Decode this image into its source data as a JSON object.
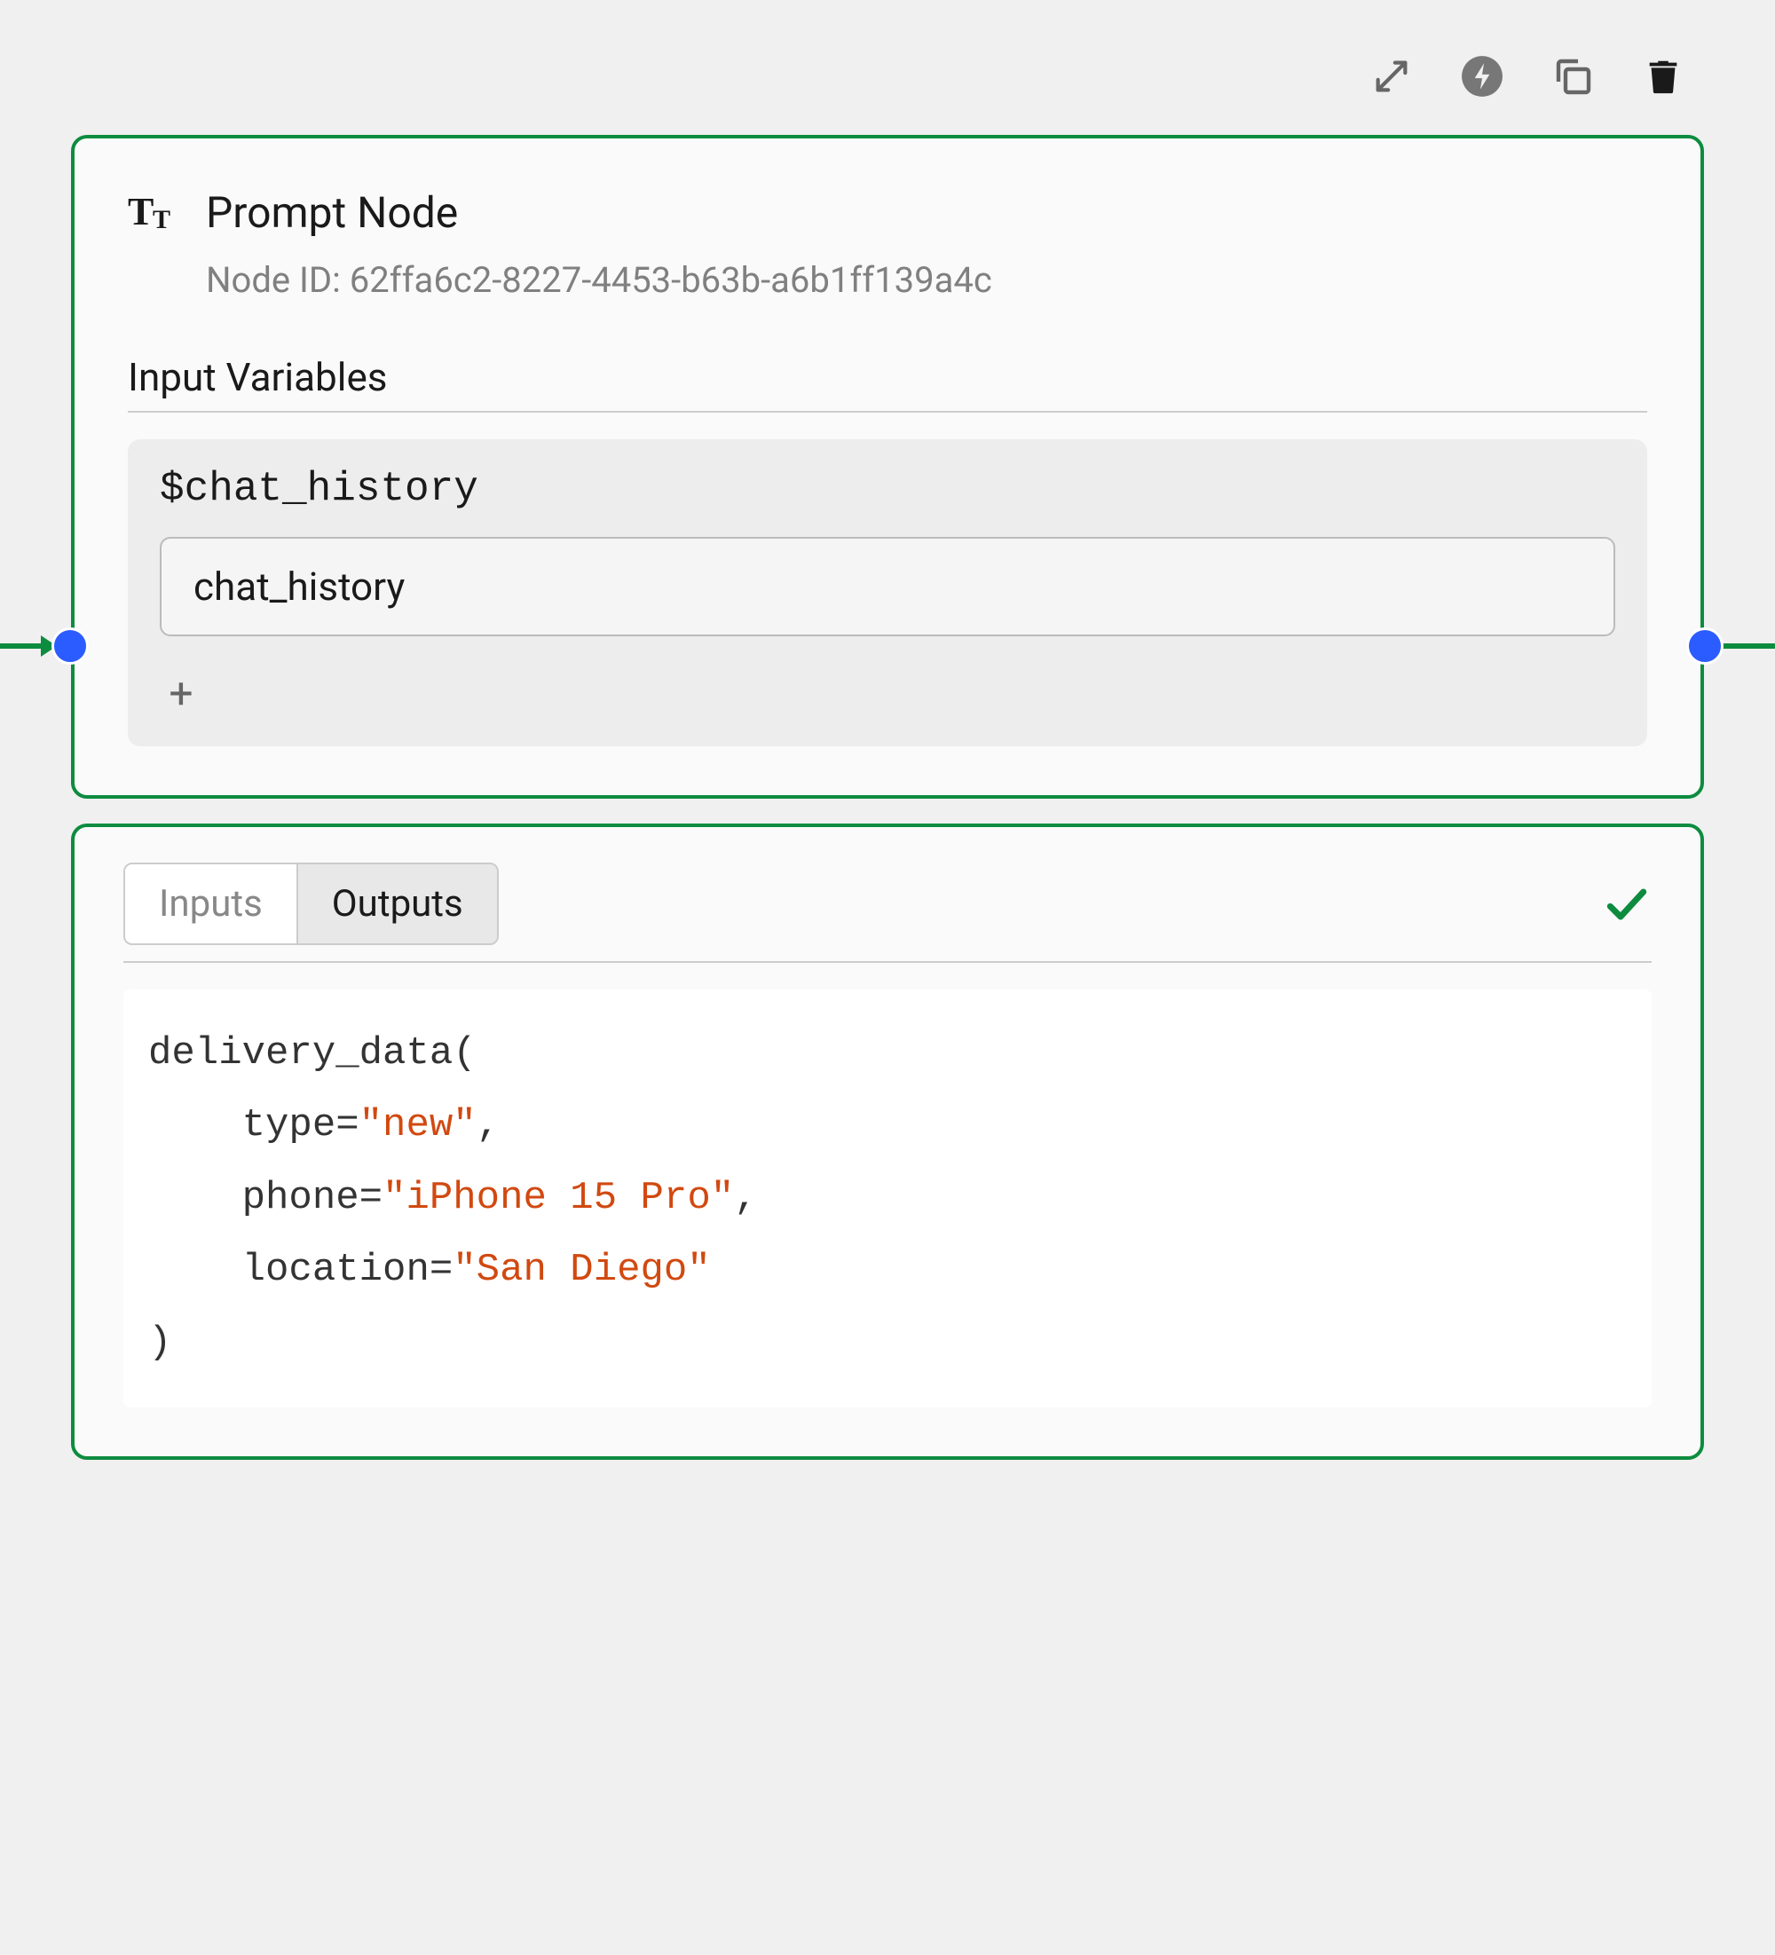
{
  "toolbar": {
    "expand": "expand",
    "lightning": "run",
    "copy": "copy",
    "trash": "delete"
  },
  "node": {
    "title": "Prompt Node",
    "id_label": "Node ID:",
    "id_value": "62ffa6c2-8227-4453-b63b-a6b1ff139a4c",
    "input_variables_label": "Input Variables",
    "variables": [
      {
        "name": "$chat_history",
        "value": "chat_history"
      }
    ],
    "add_button": "+"
  },
  "output_panel": {
    "tabs": [
      {
        "label": "Inputs",
        "active": false
      },
      {
        "label": "Outputs",
        "active": true
      }
    ],
    "status": "success",
    "code": {
      "func": "delivery_data",
      "args": [
        {
          "key": "type",
          "value": "\"new\""
        },
        {
          "key": "phone",
          "value": "\"iPhone 15 Pro\""
        },
        {
          "key": "location",
          "value": "\"San Diego\""
        }
      ]
    }
  }
}
